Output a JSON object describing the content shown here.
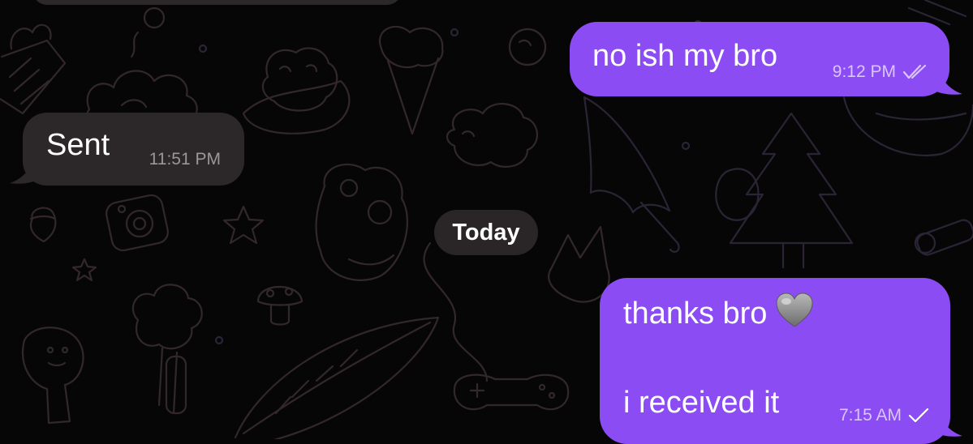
{
  "chat": {
    "date_separator": "Today",
    "messages": [
      {
        "id": "out-1",
        "direction": "outgoing",
        "text": "no ish my bro",
        "time": "9:12 PM",
        "status": "double-check-read"
      },
      {
        "id": "in-1",
        "direction": "incoming",
        "text": "Sent",
        "time": "11:51 PM"
      },
      {
        "id": "out-2",
        "direction": "outgoing",
        "text_line1": "thanks bro",
        "emoji": "grey-heart-emoji",
        "text_line2": "i received it",
        "time": "7:15 AM",
        "status": "single-check-sent"
      }
    ]
  },
  "colors": {
    "background": "#070607",
    "incoming_bubble": "#2c2728",
    "outgoing_bubble": "#8b4cf3",
    "date_chip": "#2a2526",
    "wallpaper_doodle": "#2f2526",
    "wallpaper_doodle_purple": "#2c2436"
  }
}
